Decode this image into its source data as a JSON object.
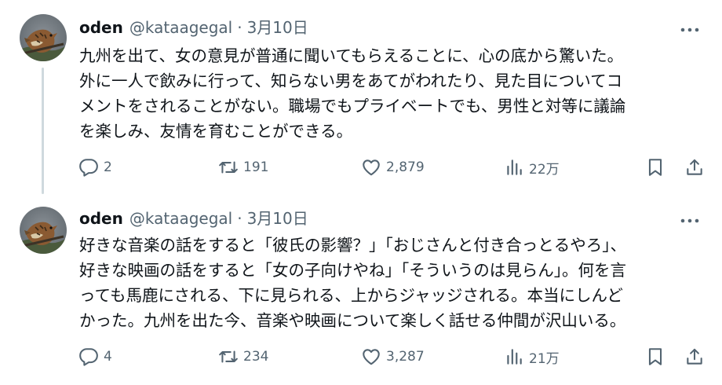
{
  "tweets": [
    {
      "author_name": "oden",
      "handle": "@kataagegal",
      "separator": "·",
      "date": "3月10日",
      "lines": [
        "九州を出て、女の意見が普通に聞いてもらえることに、心の底から驚いた。",
        "外に一人で飲みに行って、知らない男をあてがわれたり、見た目についてコ",
        "メントをされることがない。職場でもプライベートでも、男性と対等に議論",
        "を楽しみ、友情を育むことができる。"
      ],
      "replies": "2",
      "retweets": "191",
      "likes": "2,879",
      "views": "22万"
    },
    {
      "author_name": "oden",
      "handle": "@kataagegal",
      "separator": "·",
      "date": "3月10日",
      "lines": [
        "好きな音楽の話をすると「彼氏の影響？」「おじさんと付き合っとるやろ」、",
        "好きな映画の話をすると「女の子向けやね」「そういうのは見らん」。何を言",
        "っても馬鹿にされる、下に見られる、上からジャッジされる。本当にしんど",
        "かった。九州を出た今、音楽や映画について楽しく話せる仲間が沢山いる。"
      ],
      "replies": "4",
      "retweets": "234",
      "likes": "3,287",
      "views": "21万"
    }
  ],
  "icons": {
    "reply": "speech-bubble-icon",
    "retweet": "retweet-arrows-icon",
    "like": "heart-icon",
    "views": "bar-chart-icon",
    "bookmark": "bookmark-icon",
    "share": "share-upload-icon",
    "more": "more-dots-icon"
  },
  "colors": {
    "text": "#0f1419",
    "secondary": "#536471",
    "thread_line": "#cfd9de"
  }
}
